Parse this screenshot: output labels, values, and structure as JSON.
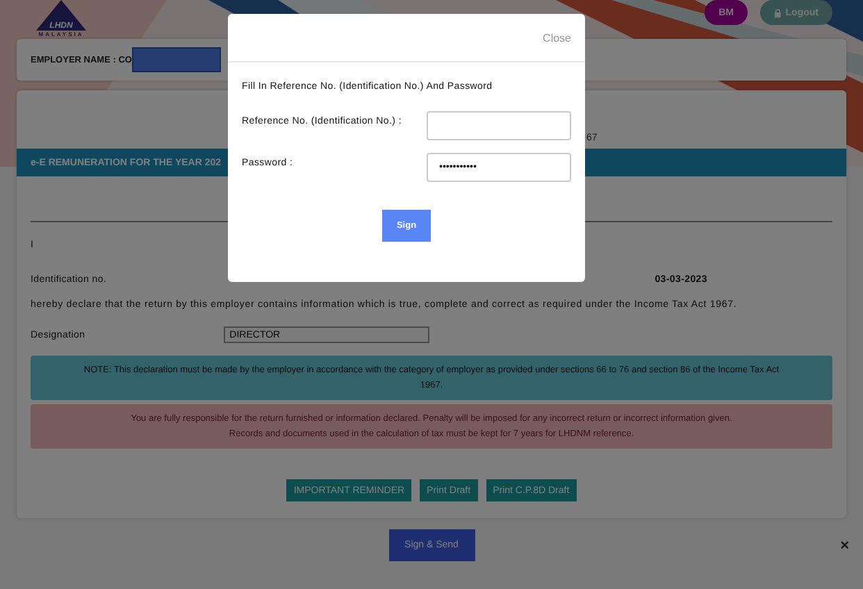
{
  "header": {
    "logo_text": "LHDN",
    "logo_subtext": "MALAYSIA",
    "buttons": [
      {
        "label": "BM",
        "kind": "language"
      },
      {
        "label": "Logout",
        "kind": "logout"
      }
    ]
  },
  "employer": {
    "label": "EMPLOYER NAME : CO",
    "redacted": true
  },
  "form": {
    "fragment": "67",
    "section_title": "e-E REMUNERATION FOR THE YEAR 202",
    "declarant": "I",
    "id_label": "Identification no.",
    "date": "03-03-2023",
    "declaration": "hereby declare that the return by this employer contains information which is true, complete and correct as required under the Income Tax Act 1967.",
    "designation_label": "Designation",
    "designation_value": "DIRECTOR",
    "note": "NOTE: This declaration must be made by the employer in accordance with the category of employer as provided under sections 66 to 76 and section 86 of the Income Tax Act 1967.",
    "warning": [
      "You are fully responsible for the return furnished or information declared. Penalty will be imposed for any incorrect return or incorrect information given.",
      "Records and documents used in the calculation of tax must be kept for 7 years for LHDNM reference."
    ],
    "actions": [
      "IMPORTANT REMINDER",
      "Print Draft",
      "Print C.P.8D Draft"
    ]
  },
  "submit": "Sign & Send",
  "dismiss": "×",
  "modal": {
    "close": "Close",
    "instruction": "Fill In Reference No. (Identification No.) And Password",
    "fields": [
      {
        "label": "Reference No. (Identification No.) :"
      },
      {
        "label": "Password :",
        "value": "•••••••••••"
      }
    ],
    "button": "Sign"
  }
}
